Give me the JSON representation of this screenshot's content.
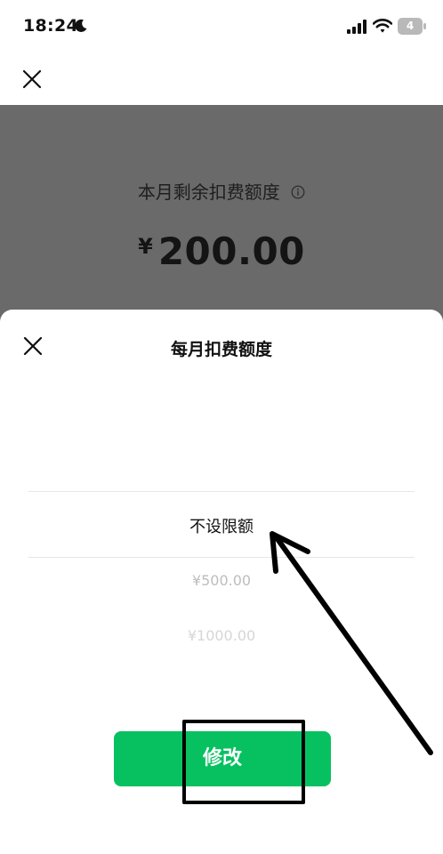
{
  "status_bar": {
    "time": "18:24",
    "battery": "4",
    "icons": [
      "moon-icon",
      "signal-icon",
      "wifi-icon",
      "battery-icon"
    ]
  },
  "background_page": {
    "remaining_label": "本月剩余扣费额度",
    "currency_symbol": "¥",
    "amount": "200.00"
  },
  "sheet": {
    "title": "每月扣费额度",
    "options": [
      "不设限额",
      "¥500.00",
      "¥1000.00"
    ],
    "selected_option": "不设限额",
    "modify_button": "修改"
  },
  "colors": {
    "accent": "#07c160",
    "overlay": "#6a6a6a",
    "annotation": "#000000"
  }
}
